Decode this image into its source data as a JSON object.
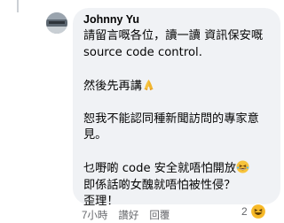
{
  "comment": {
    "author": "Johnny Yu",
    "paragraphs": [
      [
        "請留言嘅各位，讀一讀 資訊保安嘅",
        "source code control."
      ],
      [
        "然後先再講"
      ],
      [
        "恕我不能認同種新聞訪問的專家意",
        "見。"
      ],
      [
        "乜嘢啲 code 安全就唔怕開放",
        "即係話啲女醜就唔怕被性侵？",
        "歪理！"
      ]
    ],
    "emojis": {
      "pray": "folded-hands",
      "laugh": "grinning-squinting-face"
    }
  },
  "actions": {
    "time": "7小時",
    "like": "讚好",
    "reply": "回覆"
  },
  "reaction": {
    "count": "2",
    "icon": "laugh-reaction-icon",
    "color": "#f7b928"
  }
}
